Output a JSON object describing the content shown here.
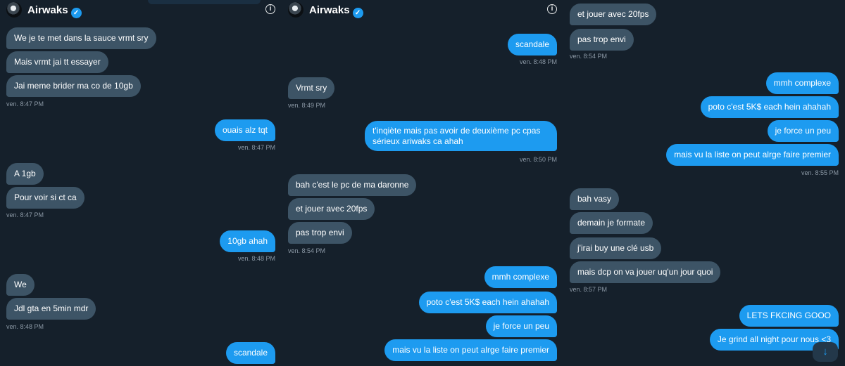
{
  "header": {
    "name": "Airwaks",
    "verified_icon": "verified-badge-icon",
    "info_icon": "info-icon"
  },
  "panel1": {
    "m1": "We je te met dans la sauce vrmt sry",
    "m2": "Mais vrmt jai tt essayer",
    "m3": "Jai meme brider ma co de 10gb",
    "t1": "ven. 8:47 PM",
    "m4": "ouais alz tqt",
    "t2": "ven. 8:47 PM",
    "m5": "A 1gb",
    "m6": "Pour voir si ct ca",
    "t3": "ven. 8:47 PM",
    "m7": "10gb ahah",
    "t4": "ven. 8:48 PM",
    "m8": "We",
    "m9": "Jdl gta en 5min mdr",
    "t5": "ven. 8:48 PM",
    "m10": "scandale"
  },
  "panel2": {
    "m1": "scandale",
    "t1": "ven. 8:48 PM",
    "m2": "Vrmt sry",
    "t2": "ven. 8:49 PM",
    "m3": "t'inqiète mais pas avoir de deuxième pc cpas sérieux ariwaks ca ahah",
    "t3": "ven. 8:50 PM",
    "m4": "bah c'est le pc de ma daronne",
    "m5": "et jouer avec 20fps",
    "m6": "pas trop envi",
    "t4": "ven. 8:54 PM",
    "m7": "mmh complexe",
    "m8": "poto c'est 5K$ each hein ahahah",
    "m9": "je force un peu",
    "m10": "mais vu la liste on peut alrge faire premier"
  },
  "panel3": {
    "m1": "et jouer avec 20fps",
    "m2": "pas trop envi",
    "t1": "ven. 8:54 PM",
    "m3": "mmh complexe",
    "m4": "poto c'est 5K$ each hein ahahah",
    "m5": "je force un peu",
    "m6": "mais vu la liste on peut alrge faire premier",
    "t2": "ven. 8:55 PM",
    "m7": "bah vasy",
    "m8": "demain je formate",
    "m9": "j'irai buy une clé usb",
    "m10": "mais dcp on va jouer uq'un jour quoi",
    "t3": "ven. 8:57 PM",
    "m11": "LETS FKCING GOOO",
    "m12": "Je grind all night pour nous <3"
  },
  "scroll_button": {
    "icon": "arrow-down-icon",
    "glyph": "↓"
  }
}
